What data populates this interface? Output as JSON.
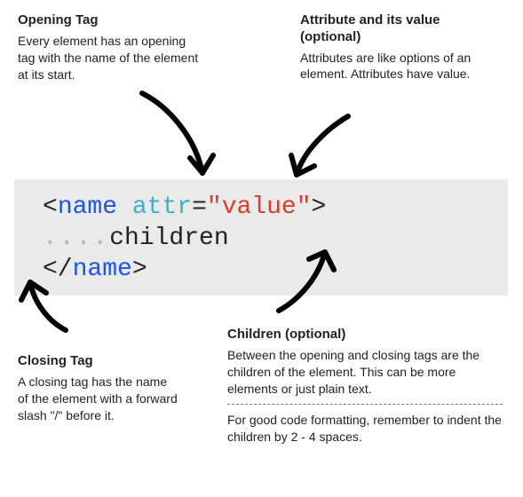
{
  "annotations": {
    "opening_tag": {
      "title": "Opening Tag",
      "body": "Every element has an opening tag with the name of the element at its start."
    },
    "attribute": {
      "title": "Attribute and its value (optional)",
      "body": "Attributes are like options of an element. Attributes have value."
    },
    "closing_tag": {
      "title": "Closing Tag",
      "body": "A closing tag has the name of the element with a forward slash \"/\" before it."
    },
    "children": {
      "title": "Children (optional)",
      "body": "Between the opening and closing tags are the children of the element. This can be more elements or just plain text.",
      "hint": "For good code formatting, remember to indent the children by 2 - 4 spaces."
    }
  },
  "code": {
    "open_lt": "<",
    "name": "name",
    "space": " ",
    "attr": "attr",
    "equals": "=",
    "quote": "\"",
    "value": "value",
    "gt": ">",
    "indent_dots": "....",
    "children": "children",
    "close_lt_slash": "</"
  }
}
